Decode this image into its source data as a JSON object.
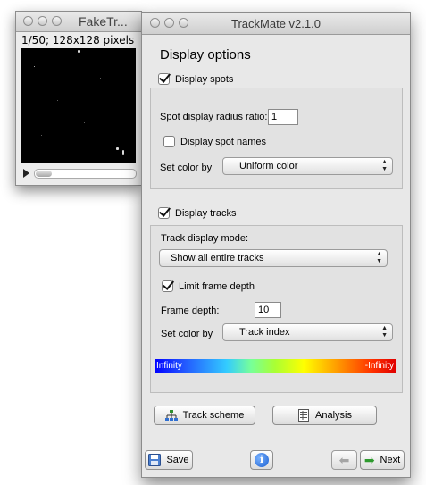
{
  "image_window": {
    "title": "FakeTr...",
    "info": "1/50; 128x128 pixels"
  },
  "trackmate_window": {
    "title": "TrackMate v2.1.0",
    "header": "Display options",
    "spots": {
      "display_label": "Display spots",
      "display_checked": true,
      "radius_label": "Spot display radius ratio:",
      "radius_value": "1",
      "names_label": "Display spot names",
      "names_checked": false,
      "color_label": "Set color by",
      "color_value": "Uniform color"
    },
    "tracks": {
      "display_label": "Display tracks",
      "display_checked": true,
      "mode_label": "Track display mode:",
      "mode_value": "Show all entire tracks",
      "limit_label": "Limit frame depth",
      "limit_checked": true,
      "depth_label": "Frame depth:",
      "depth_value": "10",
      "color_label": "Set color by",
      "color_value": "Track index",
      "gradient_min": "Infinity",
      "gradient_max": "-Infinity",
      "gradient_colors": [
        "#0000ff",
        "#33ccff",
        "#77ff99",
        "#ffff00",
        "#ff9900",
        "#e00000"
      ]
    },
    "buttons": {
      "track_scheme": "Track scheme",
      "analysis": "Analysis",
      "save": "Save",
      "next": "Next"
    },
    "icons": {
      "track_scheme": "tree-scheme-icon",
      "analysis": "table-sheet-icon",
      "save": "floppy-disk-icon",
      "info": "info-icon",
      "back": "arrow-left-icon",
      "next": "arrow-right-icon"
    }
  }
}
